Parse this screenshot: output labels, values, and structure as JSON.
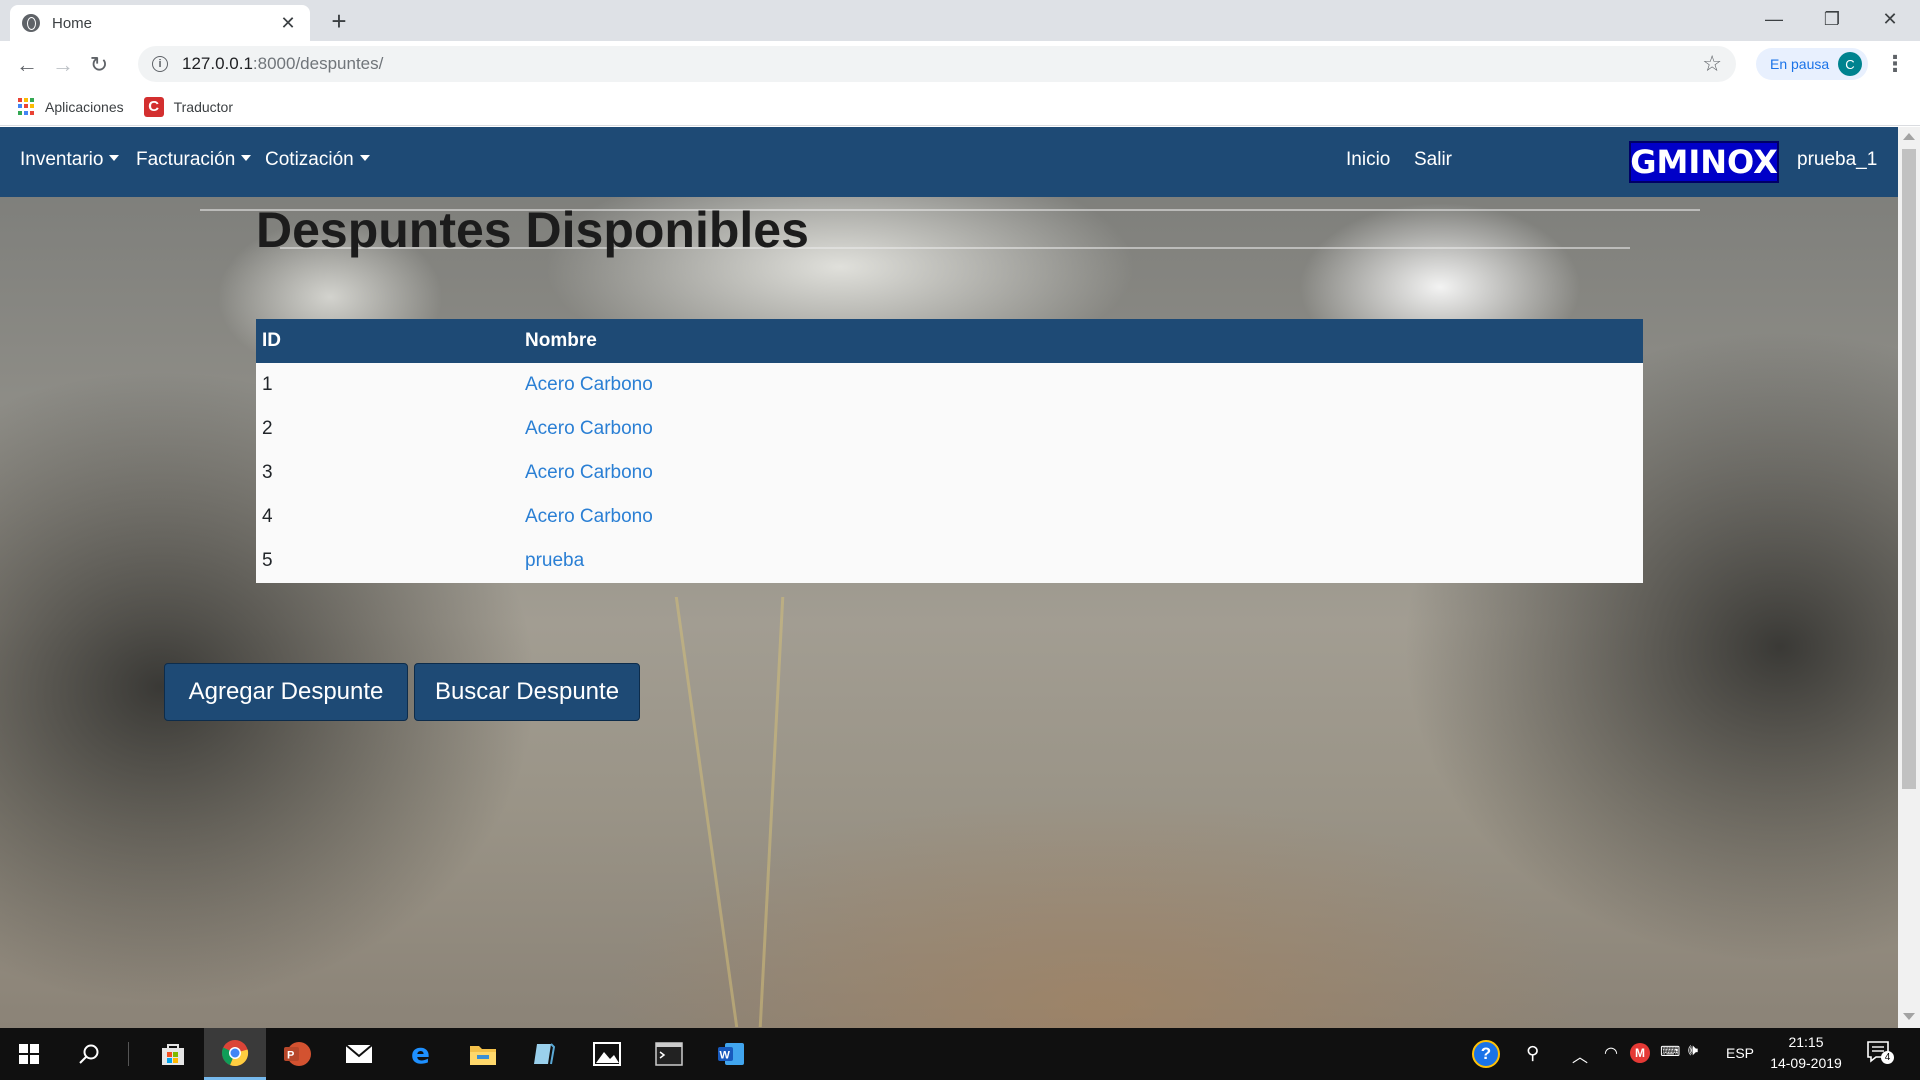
{
  "browser": {
    "tab_title": "Home",
    "tab_close": "✕",
    "new_tab": "+",
    "url_host": "127.0.0.1",
    "url_path": ":8000/despuntes/",
    "profile_status": "En pausa",
    "profile_initial": "C",
    "bookmarks": [
      {
        "label": "Aplicaciones"
      },
      {
        "label": "Traductor"
      }
    ],
    "window_controls": [
      "—",
      "❐",
      "✕"
    ]
  },
  "navbar": {
    "menus": [
      {
        "label": "Inventario"
      },
      {
        "label": "Facturación"
      },
      {
        "label": "Cotización"
      }
    ],
    "links": [
      {
        "label": "Inicio"
      },
      {
        "label": "Salir"
      }
    ],
    "brand": "GMINOX",
    "username": "prueba_1",
    "color": "#1e4a75"
  },
  "main": {
    "title": "Despuntes Disponibles",
    "table": {
      "columns": [
        "ID",
        "Nombre"
      ],
      "rows": [
        {
          "id": "1",
          "nombre": "Acero Carbono"
        },
        {
          "id": "2",
          "nombre": "Acero Carbono"
        },
        {
          "id": "3",
          "nombre": "Acero Carbono"
        },
        {
          "id": "4",
          "nombre": "Acero Carbono"
        },
        {
          "id": "5",
          "nombre": "prueba"
        }
      ]
    },
    "buttons": {
      "add": "Agregar Despunte",
      "search": "Buscar Despunte"
    }
  },
  "taskbar": {
    "language": "ESP",
    "time": "21:15",
    "date": "14-09-2019",
    "notification_count": "4"
  }
}
